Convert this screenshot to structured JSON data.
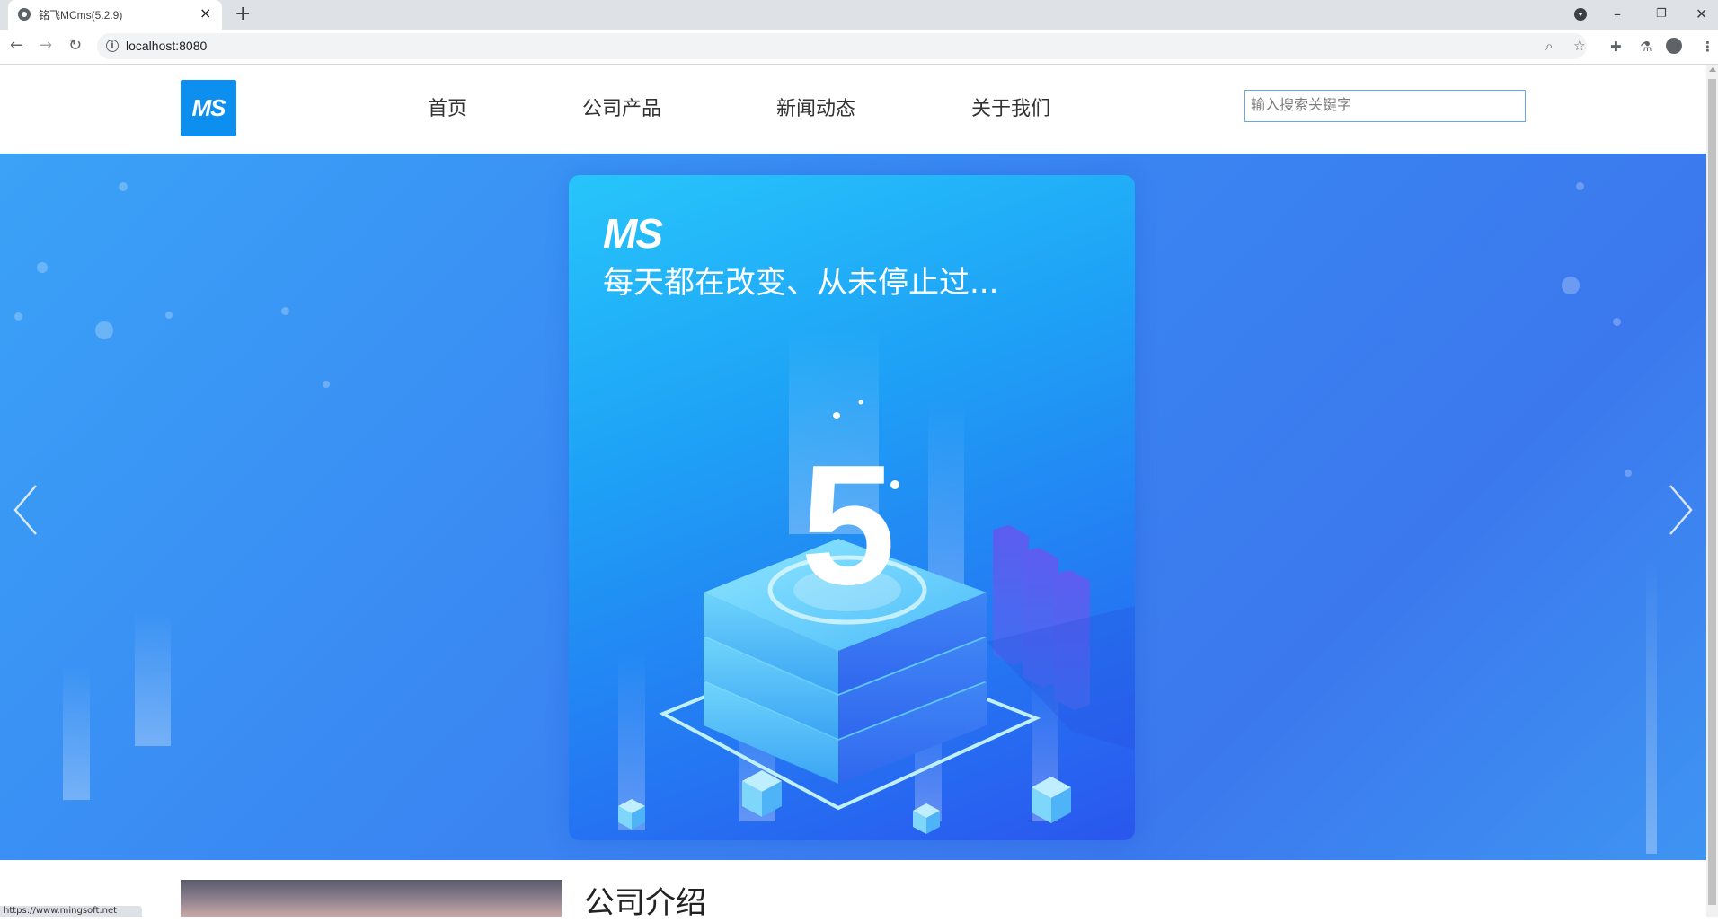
{
  "browser": {
    "tab_title": "铭飞MCms(5.2.9)",
    "tab_close": "×",
    "new_tab": "+",
    "url": "localhost:8080",
    "window_controls": {
      "minimize": "–",
      "restore": "❐",
      "close": "✕"
    },
    "icons": [
      "site-favicon-icon",
      "close-icon",
      "plus-icon",
      "profile-dropdown-icon",
      "back-arrow-icon",
      "forward-arrow-icon",
      "reload-icon",
      "info-icon",
      "zoom-icon",
      "bookmark-star-icon",
      "extensions-icon",
      "labs-flask-icon",
      "avatar-icon",
      "more-menu-icon"
    ]
  },
  "site": {
    "logo_text": "MS",
    "nav": [
      "首页",
      "公司产品",
      "新闻动态",
      "关于我们"
    ],
    "search_placeholder": "输入搜索关键字"
  },
  "banner": {
    "logo_text": "MS",
    "tagline": "每天都在改变、从未停止过...",
    "version_digit": "5",
    "colors": {
      "accent": "#0d8ff0",
      "banner": "#3a86f2"
    }
  },
  "section": {
    "title": "公司介绍"
  },
  "status_bar": {
    "text": "https://www.mingsoft.net"
  }
}
